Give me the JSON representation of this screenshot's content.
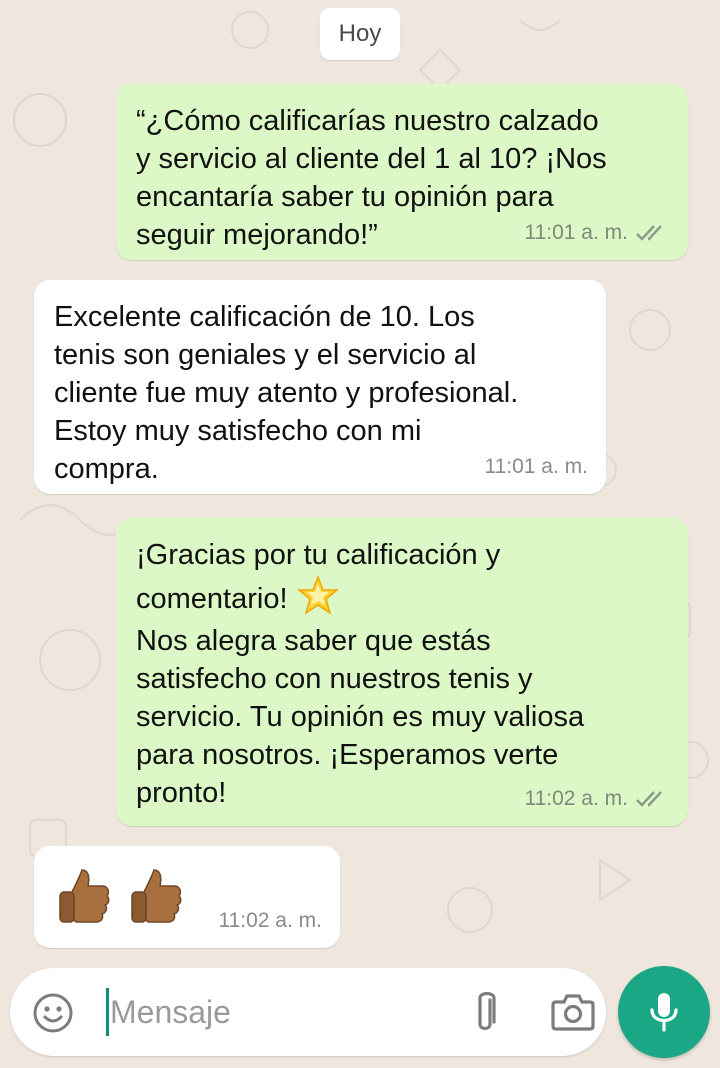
{
  "date_label": "Hoy",
  "messages": [
    {
      "direction": "out",
      "text": "“¿Cómo calificarías nuestro calzado\ny servicio al cliente del 1 al 10? ¡Nos\nencantaría saber tu opinión para\nseguir mejorando!”",
      "time": "11:01 a. m."
    },
    {
      "direction": "in",
      "text": "Excelente calificación de 10. Los\ntenis son geniales y el servicio al\ncliente fue muy atento y profesional.\nEstoy muy satisfecho con mi\ncompra.",
      "time": "11:01 a. m."
    },
    {
      "direction": "out",
      "text_line1": "¡Gracias por tu calificación y",
      "text_line2": "comentario! ",
      "text_rest": "Nos alegra saber que estás\nsatisfecho con nuestros tenis y\nservicio. Tu opinión es muy valiosa\npara nosotros. ¡Esperamos verte\npronto!",
      "time": "11:02 a. m."
    },
    {
      "direction": "in",
      "emoji": "thumbs-up-medium-dark-skin",
      "time": "11:02 a. m."
    }
  ],
  "composer": {
    "placeholder": "Mensaje"
  },
  "icons": {
    "emoji": "emoji-icon",
    "attach": "paperclip-icon",
    "camera": "camera-icon",
    "mic": "microphone-icon",
    "read_receipt": "double-check-icon"
  },
  "colors": {
    "outgoing_bubble": "#dcf8c6",
    "incoming_bubble": "#ffffff",
    "accent": "#1ba686",
    "wallpaper": "#efe7de"
  }
}
